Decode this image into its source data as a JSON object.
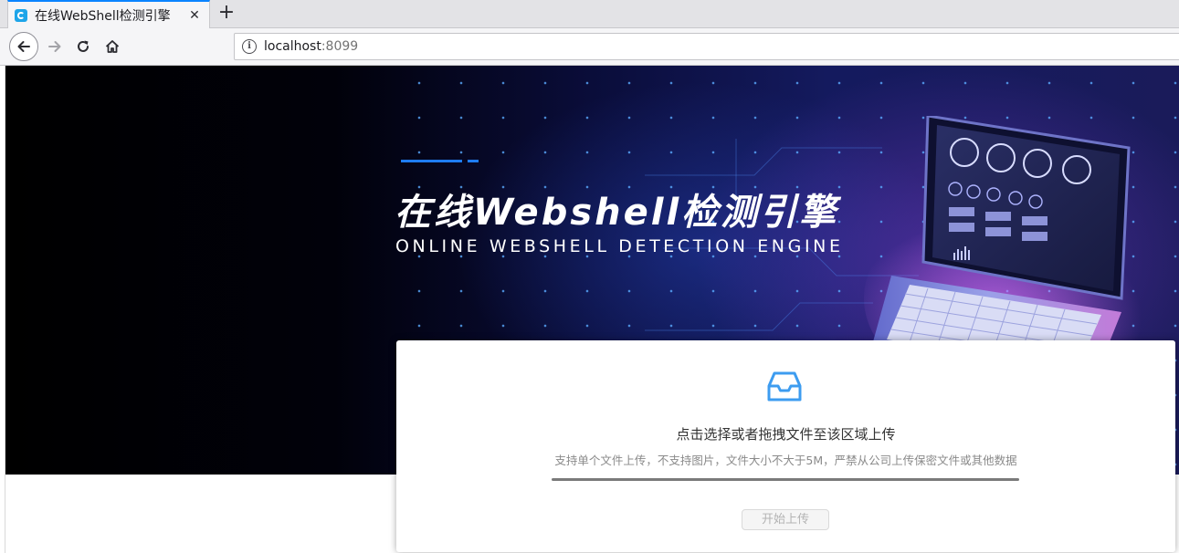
{
  "browser": {
    "tab_title": "在线WebShell检测引擎",
    "close_glyph": "✕",
    "new_tab_glyph": "+",
    "url_host": "localhost",
    "url_port": ":8099"
  },
  "hero": {
    "title": "在线Webshell检测引擎",
    "subtitle": "ONLINE WEBSHELL DETECTION ENGINE"
  },
  "upload": {
    "title": "点击选择或者拖拽文件至该区域上传",
    "hint": "支持单个文件上传，不支持图片，文件大小不大于5M，严禁从公司上传保密文件或其他数据",
    "progress_percent": 100,
    "start_button": "开始上传",
    "start_button_disabled": true
  },
  "colors": {
    "accent": "#1e7cf2",
    "icon": "#3d9cf0",
    "tab_indicator": "#0a84ff"
  }
}
